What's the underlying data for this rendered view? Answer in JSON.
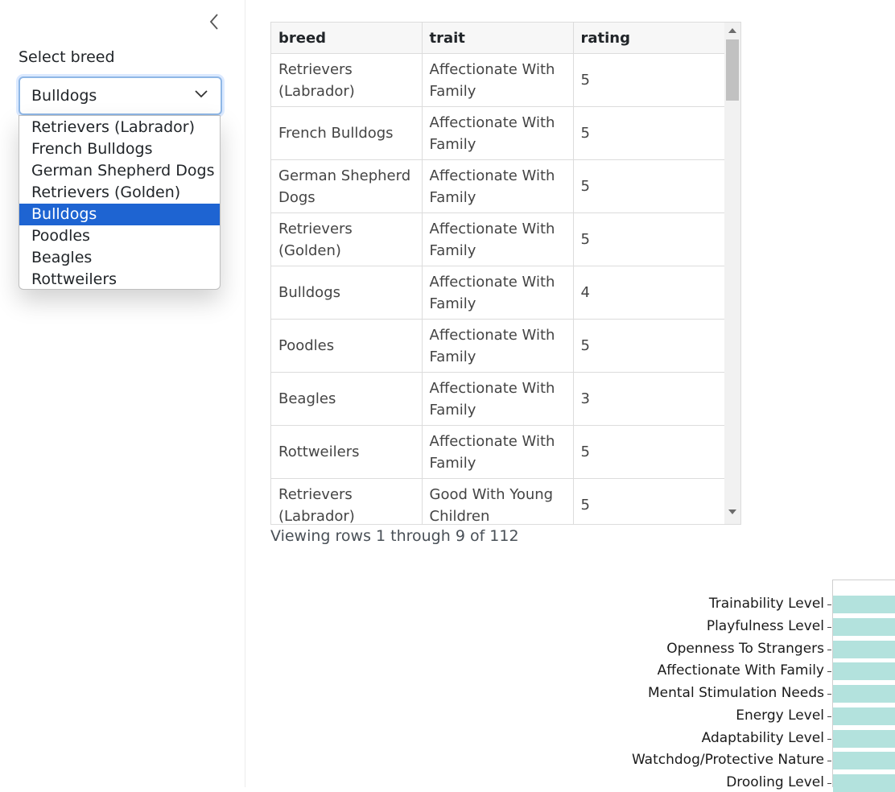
{
  "sidebar": {
    "select_label": "Select breed",
    "selected_value": "Bulldogs",
    "options": [
      "Retrievers (Labrador)",
      "French Bulldogs",
      "German Shepherd Dogs",
      "Retrievers (Golden)",
      "Bulldogs",
      "Poodles",
      "Beagles",
      "Rottweilers"
    ],
    "collapse_icon": "chevron-left-icon",
    "select_icon": "chevron-down-icon",
    "highlight_color": "#1e64d2"
  },
  "table": {
    "headers": [
      "breed",
      "trait",
      "rating"
    ],
    "rows": [
      [
        "Retrievers (Labrador)",
        "Affectionate With Family",
        "5"
      ],
      [
        "French Bulldogs",
        "Affectionate With Family",
        "5"
      ],
      [
        "German Shepherd Dogs",
        "Affectionate With Family",
        "5"
      ],
      [
        "Retrievers (Golden)",
        "Affectionate With Family",
        "5"
      ],
      [
        "Bulldogs",
        "Affectionate With Family",
        "4"
      ],
      [
        "Poodles",
        "Affectionate With Family",
        "5"
      ],
      [
        "Beagles",
        "Affectionate With Family",
        "3"
      ],
      [
        "Rottweilers",
        "Affectionate With Family",
        "5"
      ],
      [
        "Retrievers (Labrador)",
        "Good With Young Children",
        "5"
      ]
    ],
    "row_info": "Viewing rows 1 through 9 of 112"
  },
  "chart_data": {
    "type": "bar",
    "categories": [
      "Trainability Level",
      "Playfulness Level",
      "Openness To Strangers",
      "Affectionate With Family",
      "Mental Stimulation Needs",
      "Energy Level",
      "Adaptability Level",
      "Watchdog/Protective Nature",
      "Drooling Level"
    ],
    "bar_color": "#b3e2dd"
  }
}
